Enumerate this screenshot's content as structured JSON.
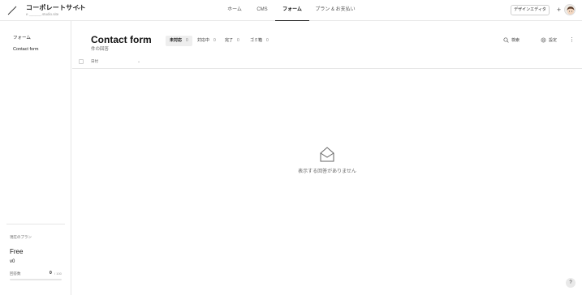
{
  "header": {
    "site_title": "コーポレートサイト",
    "site_url": "e ______.studio.site",
    "nav": [
      {
        "label": "ホーム"
      },
      {
        "label": "CMS"
      },
      {
        "label": "フォーム"
      },
      {
        "label": "プラン & お支払い"
      }
    ],
    "active_nav": "フォーム",
    "design_editor_label": "デザインエディタ",
    "add_label": "+"
  },
  "sidebar": {
    "items": [
      {
        "label": "フォーム"
      },
      {
        "label": "Contact form"
      }
    ],
    "plan": {
      "label": "現在のプラン",
      "name": "Free",
      "version": "v0",
      "responses_label": "回答数",
      "responses_count": "0",
      "responses_limit": "/ 100",
      "responses_fraction": 0
    }
  },
  "main": {
    "title": "Contact form",
    "subtitle": "件の回答",
    "tabs": [
      {
        "label": "未対応",
        "count": "0"
      },
      {
        "label": "対応中",
        "count": "0"
      },
      {
        "label": "完了",
        "count": "0"
      },
      {
        "label": "ゴミ箱",
        "count": "0"
      }
    ],
    "active_tab": "未対応",
    "search_label": "検索",
    "settings_label": "設定",
    "more_label": "⋮",
    "table": {
      "columns": [
        {
          "label": "日付"
        }
      ],
      "sort_indicator": "⌄"
    },
    "empty_message": "表示する回答がありません"
  },
  "help_label": "?",
  "colors": {
    "text": "#222222",
    "muted": "#666666",
    "border": "#e6e6e6",
    "active_tab_bg": "#eeeeee"
  },
  "icons": [
    "logo-icon",
    "chevron-down-icon",
    "avatar",
    "search-icon",
    "gear-icon",
    "more-icon",
    "envelope-open-icon",
    "help-icon"
  ]
}
